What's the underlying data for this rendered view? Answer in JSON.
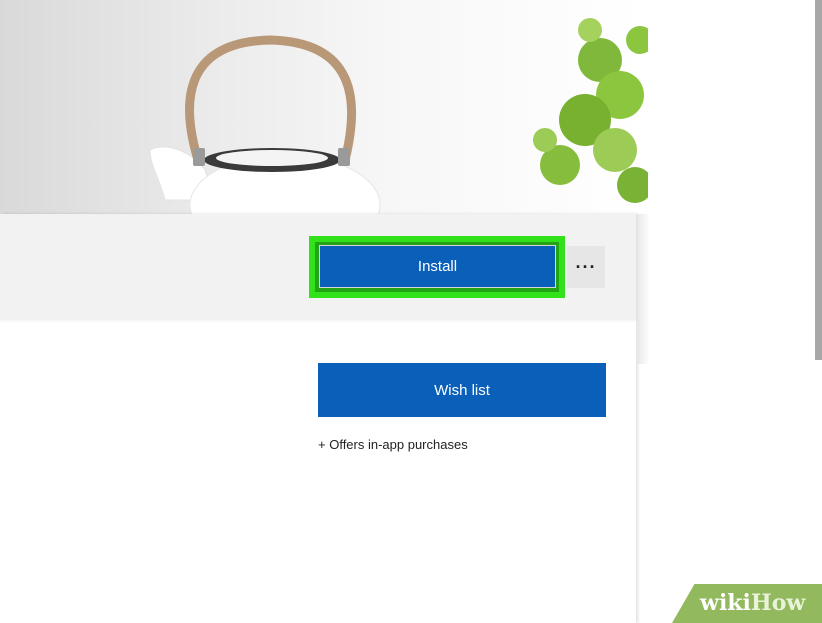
{
  "actions": {
    "install_label": "Install",
    "more_label": "···",
    "wishlist_label": "Wish list",
    "offers_text": "+ Offers in-app purchases"
  },
  "watermark": {
    "part1": "wiki",
    "part2": "How"
  },
  "colors": {
    "button_blue": "#0a5fb8",
    "highlight_green": "#31e11a",
    "watermark_green": "#93b95e"
  }
}
